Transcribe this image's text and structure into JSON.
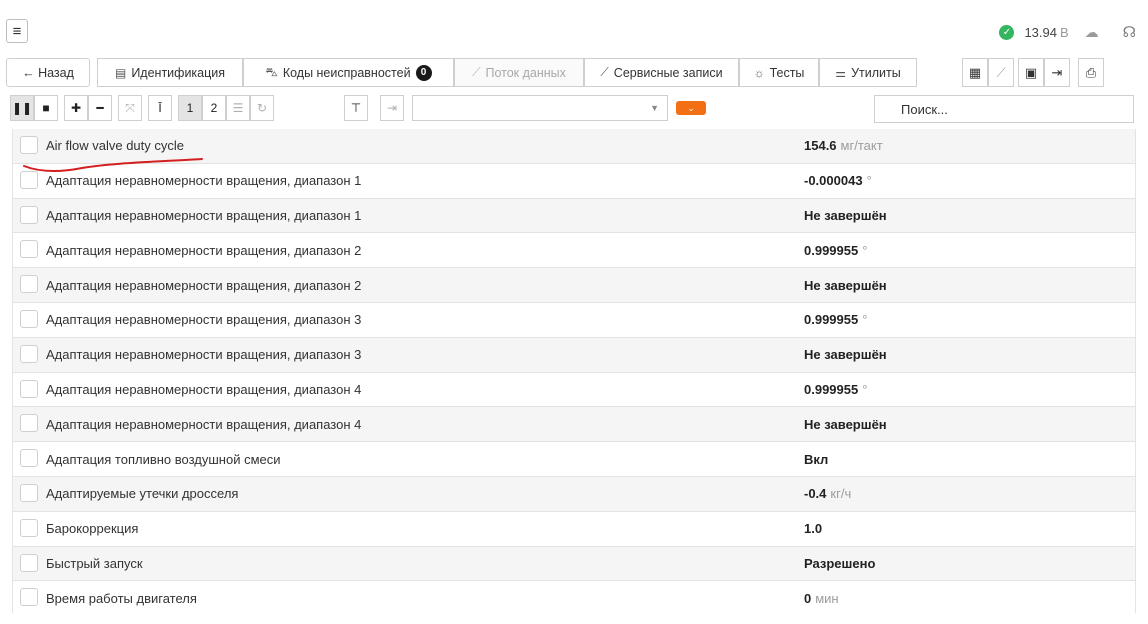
{
  "header": {
    "menu_icon": "hamburger-icon",
    "voltage_value": "13.94",
    "voltage_unit": "В",
    "status_color": "#34b55f"
  },
  "tabs": {
    "back": "← Назад",
    "identification": "Идентификация",
    "fault_codes": "Коды неисправностей",
    "fault_codes_count": "0",
    "data_stream": "Поток данных",
    "service_records": "Сервисные записи",
    "tests": "Тесты",
    "utilities": "Утилиты"
  },
  "toolbar": {
    "page1": "1",
    "page2": "2",
    "search_placeholder": "Поиск...",
    "accent_color": "#f26f14"
  },
  "rows": [
    {
      "name": "Air flow valve duty cycle",
      "value": "154.6",
      "unit": "мг/такт"
    },
    {
      "name": "Адаптация неравномерности вращения, диапазон 1",
      "value": "-0.000043",
      "unit": "°"
    },
    {
      "name": "Адаптация неравномерности вращения, диапазон 1",
      "value": "Не завершён",
      "unit": ""
    },
    {
      "name": "Адаптация неравномерности вращения, диапазон 2",
      "value": "0.999955",
      "unit": "°"
    },
    {
      "name": "Адаптация неравномерности вращения, диапазон 2",
      "value": "Не завершён",
      "unit": ""
    },
    {
      "name": "Адаптация неравномерности вращения, диапазон 3",
      "value": "0.999955",
      "unit": "°"
    },
    {
      "name": "Адаптация неравномерности вращения, диапазон 3",
      "value": "Не завершён",
      "unit": ""
    },
    {
      "name": "Адаптация неравномерности вращения, диапазон 4",
      "value": "0.999955",
      "unit": "°"
    },
    {
      "name": "Адаптация неравномерности вращения, диапазон 4",
      "value": "Не завершён",
      "unit": ""
    },
    {
      "name": "Адаптация топливно воздушной смеси",
      "value": "Вкл",
      "unit": ""
    },
    {
      "name": "Адаптируемые утечки дросселя",
      "value": "-0.4",
      "unit": "кг/ч"
    },
    {
      "name": "Барокоррекция",
      "value": "1.0",
      "unit": ""
    },
    {
      "name": "Быстрый запуск",
      "value": "Разрешено",
      "unit": ""
    },
    {
      "name": "Время работы двигателя",
      "value": "0",
      "unit": "мин"
    }
  ]
}
